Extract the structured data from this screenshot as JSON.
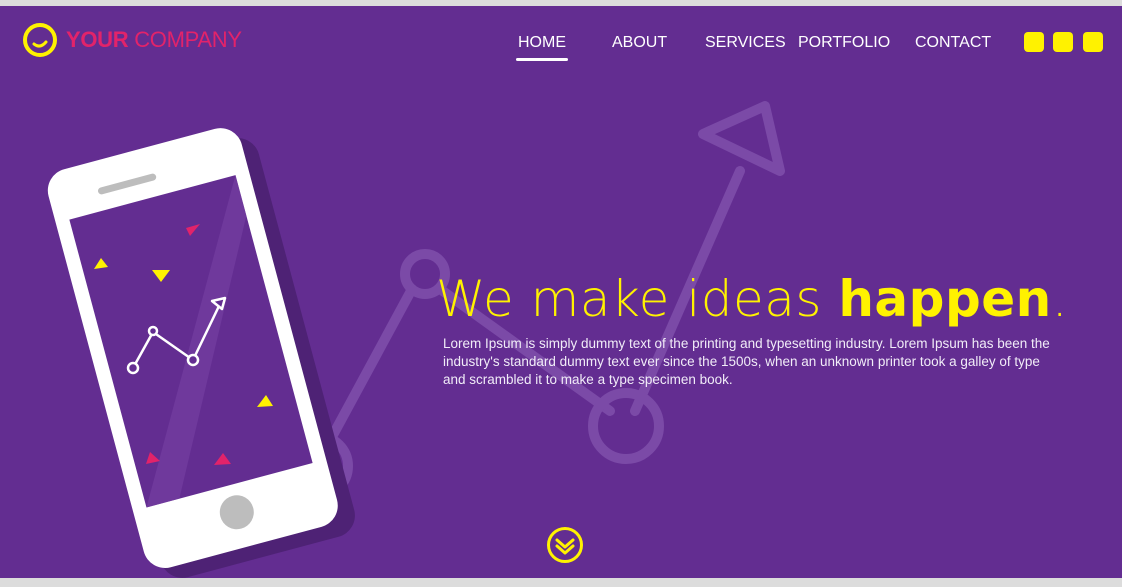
{
  "brand": {
    "name_bold": "YOUR",
    "name_light": "COMPANY",
    "accent_color": "#e2236a",
    "highlight_color": "#fff200",
    "background_color": "#632d91"
  },
  "nav": {
    "items": [
      {
        "label": "HOME",
        "active": true
      },
      {
        "label": "ABOUT",
        "active": false
      },
      {
        "label": "SERVICES",
        "active": false
      },
      {
        "label": "PORTFOLIO",
        "active": false
      },
      {
        "label": "CONTACT",
        "active": false
      }
    ]
  },
  "social_icons": [
    "social-square-icon",
    "social-square-icon",
    "social-square-icon"
  ],
  "hero": {
    "headline_light": "We make ideas ",
    "headline_bold": "happen",
    "headline_period": ".",
    "body": "Lorem Ipsum is simply dummy text of the printing and typesetting industry. Lorem Ipsum has been the industry's standard dummy text ever since the 1500s, when an unknown printer took a galley of type and scrambled it to make a type specimen book."
  },
  "scroll_icon": "double-chevron-down-icon"
}
